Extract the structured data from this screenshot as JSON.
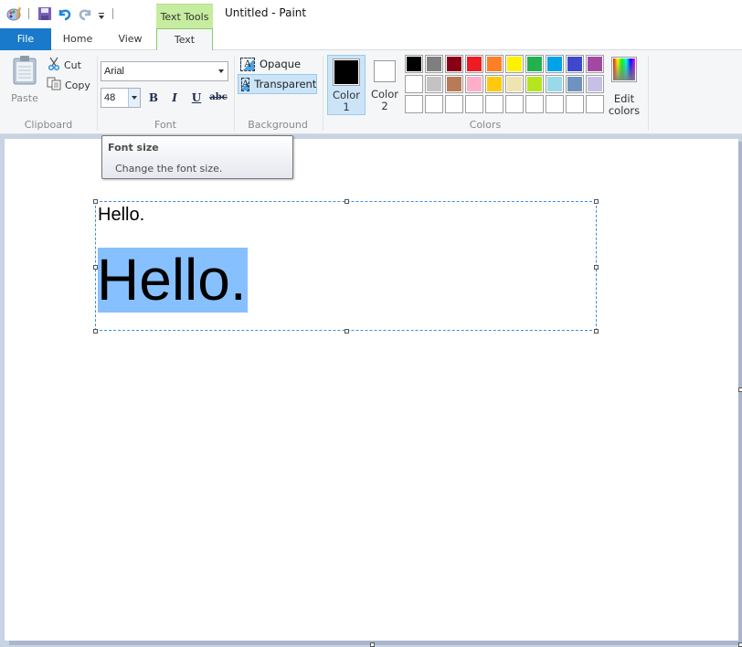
{
  "window": {
    "title": "Untitled - Paint",
    "context_tab_header": "Text Tools"
  },
  "quick_access": {
    "items": [
      {
        "name": "paint-app-icon"
      },
      {
        "name": "save-icon"
      },
      {
        "name": "undo-icon"
      },
      {
        "name": "redo-icon"
      },
      {
        "name": "customize-qat-icon"
      }
    ]
  },
  "tabs": [
    {
      "label": "File",
      "active": false
    },
    {
      "label": "Home",
      "active": false
    },
    {
      "label": "View",
      "active": false
    },
    {
      "label": "Text",
      "active": true
    }
  ],
  "ribbon": {
    "clipboard": {
      "label": "Clipboard",
      "paste": "Paste",
      "cut": "Cut",
      "copy": "Copy"
    },
    "font": {
      "label": "Font",
      "family": "Arial",
      "size": "48",
      "bold": "B",
      "italic": "I",
      "underline": "U",
      "strikethrough": "abc"
    },
    "background": {
      "label": "Background",
      "opaque": "Opaque",
      "transparent": "Transparent",
      "selected": "Transparent"
    },
    "colors": {
      "label": "Colors",
      "color1_label_line1": "Color",
      "color1_label_line2": "1",
      "color2_label_line1": "Color",
      "color2_label_line2": "2",
      "color1_value": "#000000",
      "color2_value": "#ffffff",
      "edit_colors_line1": "Edit",
      "edit_colors_line2": "colors",
      "palette_row1": [
        "#000000",
        "#7f7f7f",
        "#880015",
        "#ed1c24",
        "#ff7f27",
        "#fff200",
        "#22b14c",
        "#00a2e8",
        "#3f48cc",
        "#a349a4"
      ],
      "palette_row2": [
        "#ffffff",
        "#c3c3c3",
        "#b97a57",
        "#ffaec9",
        "#ffc90e",
        "#efe4b0",
        "#b5e61d",
        "#99d9ea",
        "#7092be",
        "#c8bfe7"
      ],
      "palette_row3": [
        "#ffffff",
        "#ffffff",
        "#ffffff",
        "#ffffff",
        "#ffffff",
        "#ffffff",
        "#ffffff",
        "#ffffff",
        "#ffffff",
        "#ffffff"
      ]
    }
  },
  "tooltip": {
    "title": "Font size",
    "body": "Change the font size."
  },
  "canvas": {
    "text_line1": "Hello.",
    "text_line2": "Hello.",
    "selection_color": "#87c0ff"
  }
}
